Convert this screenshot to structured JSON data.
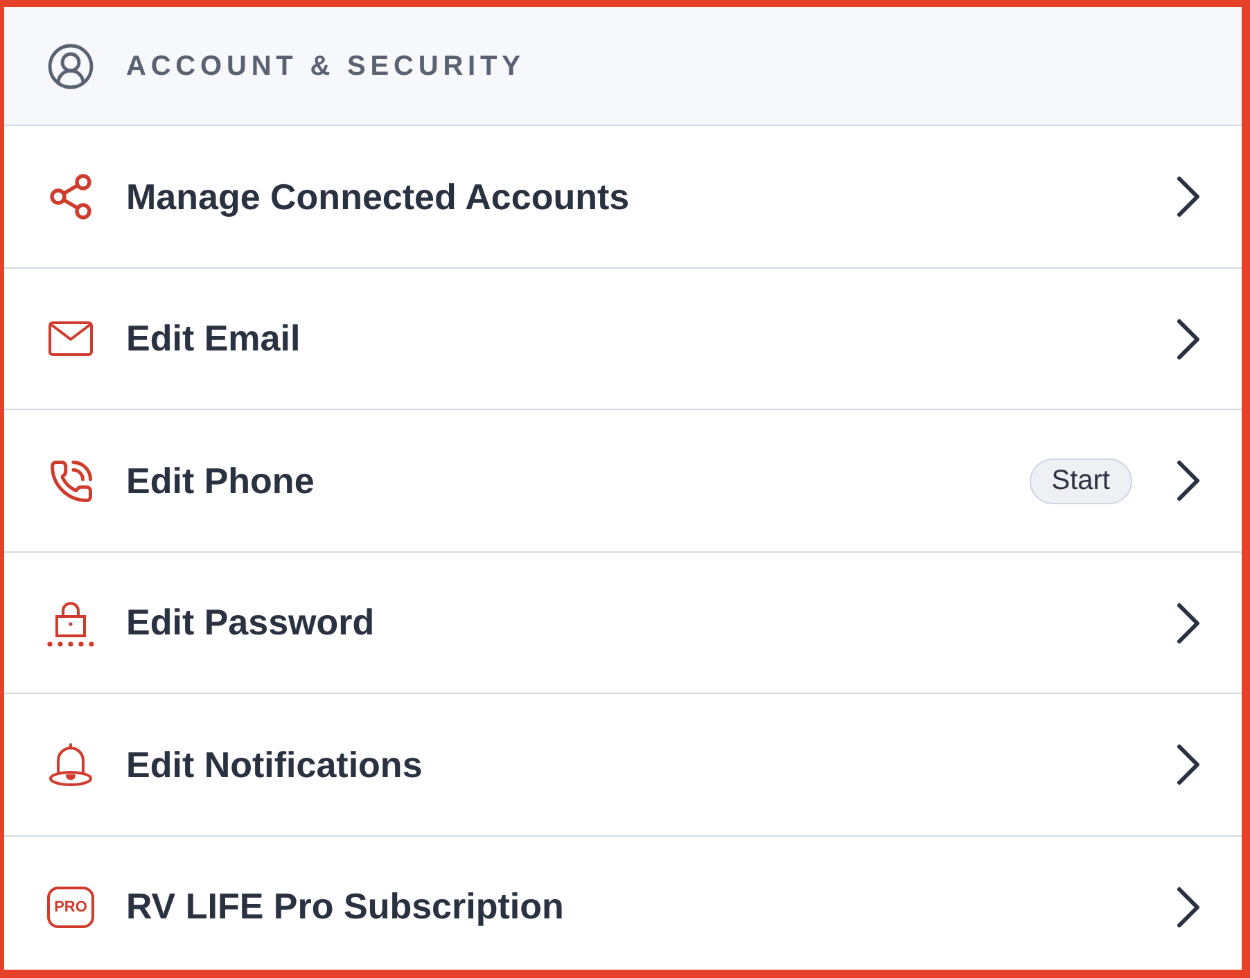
{
  "header": {
    "title": "ACCOUNT & SECURITY"
  },
  "items": [
    {
      "label": "Manage Connected Accounts"
    },
    {
      "label": "Edit Email"
    },
    {
      "label": "Edit Phone",
      "badge": "Start"
    },
    {
      "label": "Edit Password"
    },
    {
      "label": "Edit Notifications"
    },
    {
      "label": "RV LIFE Pro Subscription",
      "icon_label": "PRO"
    }
  ]
}
